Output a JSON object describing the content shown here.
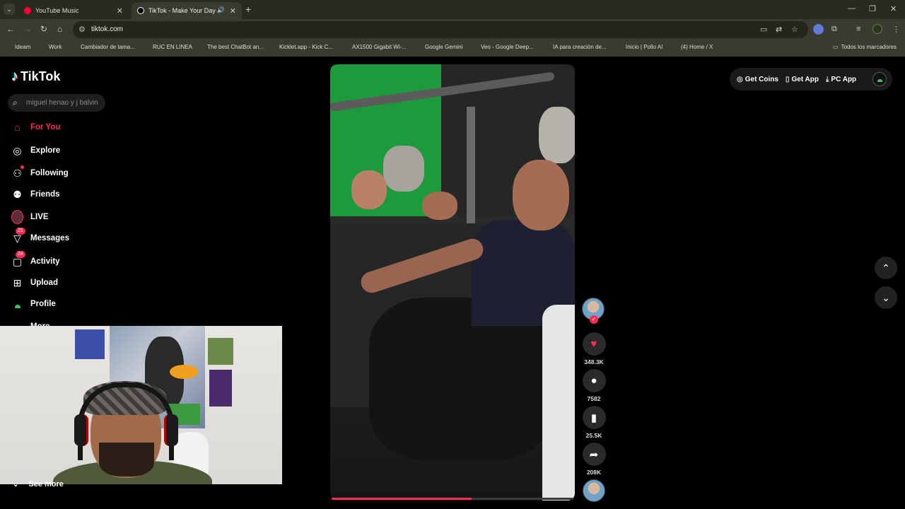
{
  "browser": {
    "tabs": [
      {
        "title": "YouTube Music",
        "color": "#ff0033"
      },
      {
        "title": "TikTok - Make Your Day",
        "color": "#ffffff"
      }
    ],
    "new_tab": "+",
    "url": "tiktok.com",
    "bookmarks": [
      {
        "label": "Ideam",
        "color": "#e6e6e6"
      },
      {
        "label": "Work",
        "color": "#e6e6e6"
      },
      {
        "label": "Cambiador de tama...",
        "color": "#333333"
      },
      {
        "label": "RUC EN LINEA",
        "color": "#1a73e8"
      },
      {
        "label": "The best ChatBot an...",
        "color": "#ffffff"
      },
      {
        "label": "Kicklet.app - Kick C...",
        "color": "#777777"
      },
      {
        "label": "AX1500 Gigabit Wi-...",
        "color": "#4ab9b5"
      },
      {
        "label": "Google Gemini",
        "color": "#8ab4f8"
      },
      {
        "label": "Veo - Google Deep...",
        "color": "#4285f4"
      },
      {
        "label": "IA para creación de...",
        "color": "#cccccc"
      },
      {
        "label": "Inicio | Pollo AI",
        "color": "#ffffff"
      },
      {
        "label": "(4) Home / X",
        "color": "#ffffff"
      }
    ],
    "all_bookmarks": "Todos los marcadores"
  },
  "tiktok": {
    "logo_text": "TikTok",
    "search_placeholder": "miguel henao y j balvin",
    "nav": [
      {
        "label": "For You",
        "icon": "home-icon"
      },
      {
        "label": "Explore",
        "icon": "compass-icon"
      },
      {
        "label": "Following",
        "icon": "following-icon"
      },
      {
        "label": "Friends",
        "icon": "friends-icon"
      },
      {
        "label": "LIVE",
        "icon": "live-icon"
      },
      {
        "label": "Messages",
        "icon": "messages-icon",
        "badge": "21"
      },
      {
        "label": "Activity",
        "icon": "activity-icon",
        "badge": "24"
      },
      {
        "label": "Upload",
        "icon": "upload-icon"
      },
      {
        "label": "Profile",
        "icon": "profile-icon"
      },
      {
        "label": "More",
        "icon": "more-icon"
      }
    ],
    "see_more": "See more",
    "top_actions": {
      "get_coins": "Get Coins",
      "get_app": "Get App",
      "pc_app": "PC App"
    },
    "actions": {
      "likes": "348.3K",
      "comments": "7582",
      "saves": "25.5K",
      "shares": "208K"
    },
    "video_progress_percent": 58,
    "colors": {
      "accent": "#fe2c55",
      "live_green": "#3fc15b"
    }
  }
}
